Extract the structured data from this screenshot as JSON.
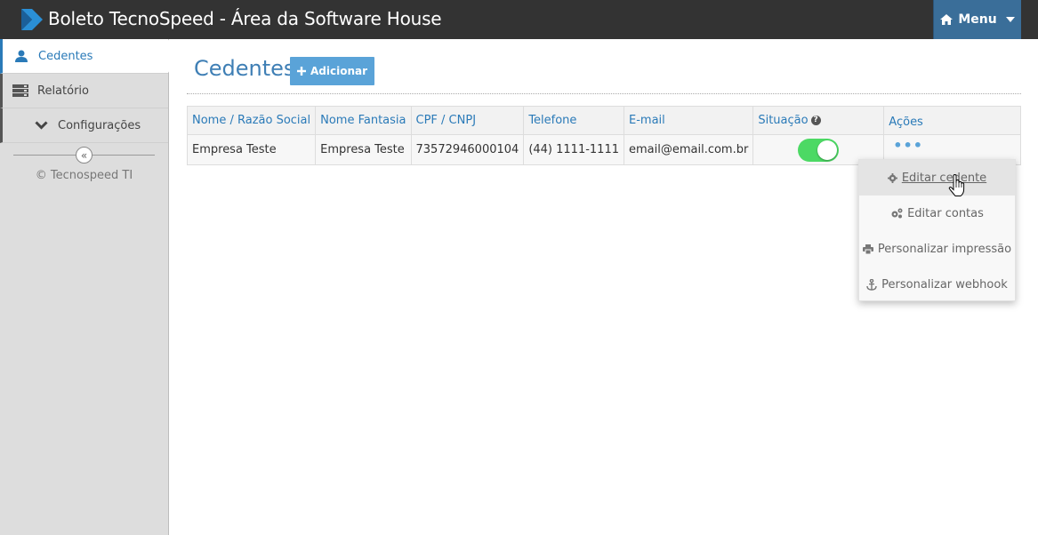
{
  "app": {
    "title": "Boleto TecnoSpeed - Área da Software House"
  },
  "header": {
    "menu_label": "Menu",
    "menu_icon": "home-icon",
    "accent": "#3a6e99"
  },
  "sidebar": {
    "items": [
      {
        "label": "Cedentes",
        "icon": "user-icon",
        "active": true
      },
      {
        "label": "Relatório",
        "icon": "server-icon",
        "active": false
      },
      {
        "label": "Configurações",
        "icon": "chevron-down-icon",
        "active": false
      }
    ],
    "collapse_glyph": "«",
    "copyright": "© Tecnospeed TI"
  },
  "main": {
    "title": "Cedentes",
    "add_button": {
      "label": "Adicionar",
      "icon": "plus-icon"
    },
    "table": {
      "columns": [
        "Nome / Razão Social",
        "Nome Fantasia",
        "CPF / CNPJ",
        "Telefone",
        "E-mail",
        "Situação",
        "Ações"
      ],
      "rows": [
        {
          "razao_social": "Empresa Teste",
          "nome_fantasia": "Empresa Teste",
          "cpf_cnpj": "73572946000104",
          "telefone": "(44) 1111-1111",
          "email": "email@email.com.br",
          "situacao_active": true,
          "acoes": "•••"
        }
      ]
    },
    "actions_menu": [
      {
        "label": "Editar cedente",
        "icon": "gear-icon",
        "hovered": true
      },
      {
        "label": "Editar contas",
        "icon": "gears-icon",
        "hovered": false
      },
      {
        "label": "Personalizar impressão",
        "icon": "print-icon",
        "hovered": false
      },
      {
        "label": "Personalizar webhook",
        "icon": "anchor-icon",
        "hovered": false
      }
    ]
  },
  "colors": {
    "link_blue": "#2a7ab8",
    "toggle_on": "#4cd964",
    "button_blue": "#5aa3d8",
    "topbar": "#333333"
  }
}
